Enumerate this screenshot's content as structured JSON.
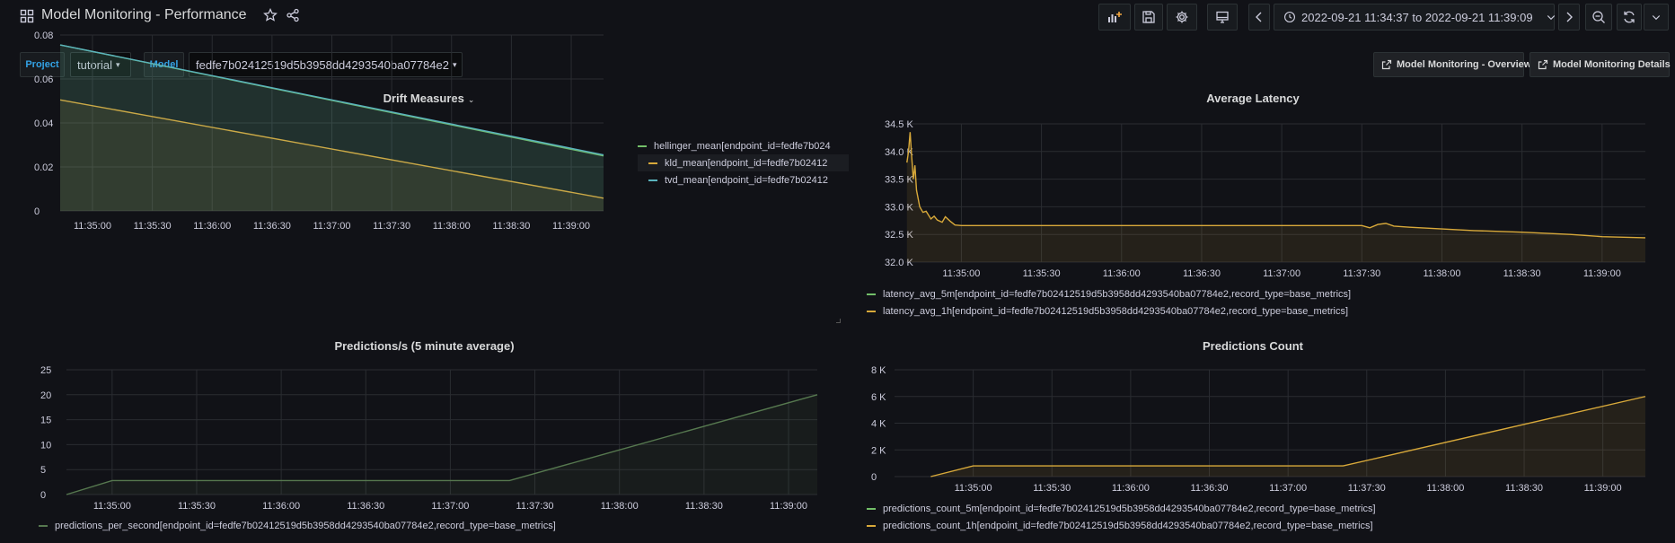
{
  "topbar": {
    "title": "Model Monitoring - Performance",
    "time_range": "2022-09-21 11:34:37 to 2022-09-21 11:39:09",
    "icons": [
      "apps-icon",
      "star-icon",
      "share-icon",
      "add-panel-icon",
      "save-icon",
      "gear-icon",
      "tv-icon",
      "chevron-left-icon",
      "clock-icon",
      "chevron-down-icon",
      "chevron-right-icon",
      "zoom-out-icon",
      "refresh-icon"
    ]
  },
  "variables": {
    "project_label": "Project",
    "project_value": "tutorial",
    "model_label": "Model",
    "model_value": "fedfe7b02412519d5b3958dd4293540ba07784e2"
  },
  "links": [
    {
      "label": "Model Monitoring - Overview"
    },
    {
      "label": "Model Monitoring Details"
    }
  ],
  "colors": {
    "background": "#111217",
    "green": "#73bf69",
    "green_dim": "#56784f",
    "yellow": "#d8a93a",
    "cyan": "#5ab3bd",
    "accent": "#33a2e5",
    "grid": "#2a2c31",
    "tick_text": "#ccccdc"
  },
  "panels": {
    "drift": {
      "title": "Drift Measures",
      "chart_data": {
        "type": "line",
        "x": [
          "11:35:00",
          "11:35:30",
          "11:36:00",
          "11:36:30",
          "11:37:00",
          "11:37:30",
          "11:38:00",
          "11:38:30",
          "11:39:00"
        ],
        "xlim": [
          -0.27,
          4.27
        ],
        "yticks": [
          "0",
          "0.02",
          "0.04",
          "0.06",
          "0.08"
        ],
        "ylim": [
          0,
          0.08
        ],
        "series": [
          {
            "name": "hellinger_mean[endpoint_id=fedfe7b024",
            "color": "#73bf69",
            "points": [
              [
                -0.27,
                0.0755
              ],
              [
                4.27,
                0.025
              ]
            ]
          },
          {
            "name": "kld_mean[endpoint_id=fedfe7b02412",
            "color": "#d8a93a",
            "points": [
              [
                -0.27,
                0.0505
              ],
              [
                4.27,
                0.0058
              ]
            ]
          },
          {
            "name": "tvd_mean[endpoint_id=fedfe7b02412",
            "color": "#5ab3bd",
            "points": [
              [
                -0.27,
                0.0755
              ],
              [
                4.27,
                0.0255
              ]
            ]
          }
        ]
      }
    },
    "latency": {
      "title": "Average Latency",
      "chart_data": {
        "type": "line",
        "x": [
          "11:35:00",
          "11:35:30",
          "11:36:00",
          "11:36:30",
          "11:37:00",
          "11:37:30",
          "11:38:00",
          "11:38:30",
          "11:39:00"
        ],
        "xlim": [
          -0.35,
          4.27
        ],
        "yticks": [
          "32.0 K",
          "32.5 K",
          "33.0 K",
          "33.5 K",
          "34.0 K",
          "34.5 K"
        ],
        "ylim": [
          32000,
          34500
        ],
        "series": [
          {
            "name": "latency_avg_5m[endpoint_id=fedfe7b02412519d5b3958dd4293540ba07784e2,record_type=base_metrics]",
            "color": "#73bf69",
            "points": []
          },
          {
            "name": "latency_avg_1h[endpoint_id=fedfe7b02412519d5b3958dd4293540ba07784e2,record_type=base_metrics]",
            "color": "#d8a93a",
            "points": [
              [
                -0.34,
                33800
              ],
              [
                -0.33,
                34000
              ],
              [
                -0.32,
                34350
              ],
              [
                -0.31,
                33900
              ],
              [
                -0.3,
                33500
              ],
              [
                -0.29,
                33750
              ],
              [
                -0.28,
                33300
              ],
              [
                -0.26,
                33000
              ],
              [
                -0.24,
                32900
              ],
              [
                -0.22,
                32920
              ],
              [
                -0.19,
                32780
              ],
              [
                -0.17,
                32830
              ],
              [
                -0.15,
                32760
              ],
              [
                -0.12,
                32720
              ],
              [
                -0.1,
                32820
              ],
              [
                -0.07,
                32740
              ],
              [
                -0.04,
                32670
              ],
              [
                0.0,
                32660
              ],
              [
                1.5,
                32660
              ],
              [
                2.2,
                32660
              ],
              [
                2.5,
                32660
              ],
              [
                2.55,
                32620
              ],
              [
                2.6,
                32680
              ],
              [
                2.65,
                32700
              ],
              [
                2.7,
                32650
              ],
              [
                2.8,
                32630
              ],
              [
                3.0,
                32600
              ],
              [
                3.2,
                32570
              ],
              [
                3.5,
                32540
              ],
              [
                3.8,
                32500
              ],
              [
                4.0,
                32460
              ],
              [
                4.27,
                32440
              ]
            ]
          }
        ]
      }
    },
    "predictions_rate": {
      "title": "Predictions/s (5 minute average)",
      "chart_data": {
        "type": "line",
        "x": [
          "11:35:00",
          "11:35:30",
          "11:36:00",
          "11:36:30",
          "11:37:00",
          "11:37:30",
          "11:38:00",
          "11:38:30",
          "11:39:00"
        ],
        "xlim": [
          -0.27,
          4.17
        ],
        "yticks": [
          "0",
          "5",
          "10",
          "15",
          "20",
          "25"
        ],
        "ylim": [
          0,
          25
        ],
        "series": [
          {
            "name": "predictions_per_second[endpoint_id=fedfe7b02412519d5b3958dd4293540ba07784e2,record_type=base_metrics]",
            "color": "#56784f",
            "points": [
              [
                -0.27,
                0
              ],
              [
                0.0,
                2.8
              ],
              [
                2.35,
                2.8
              ],
              [
                4.17,
                20
              ]
            ]
          }
        ]
      }
    },
    "predictions_count": {
      "title": "Predictions Count",
      "chart_data": {
        "type": "line",
        "x": [
          "11:35:00",
          "11:35:30",
          "11:36:00",
          "11:36:30",
          "11:37:00",
          "11:37:30",
          "11:38:00",
          "11:38:30",
          "11:39:00"
        ],
        "xlim": [
          -0.5,
          4.27
        ],
        "yticks": [
          "0",
          "2 K",
          "4 K",
          "6 K",
          "8 K"
        ],
        "ylim": [
          0,
          8000
        ],
        "series": [
          {
            "name": "predictions_count_5m[endpoint_id=fedfe7b02412519d5b3958dd4293540ba07784e2,record_type=base_metrics]",
            "color": "#73bf69",
            "points": []
          },
          {
            "name": "predictions_count_1h[endpoint_id=fedfe7b02412519d5b3958dd4293540ba07784e2,record_type=base_metrics]",
            "color": "#d8a93a",
            "points": [
              [
                -0.27,
                0
              ],
              [
                0.0,
                800
              ],
              [
                2.35,
                800
              ],
              [
                4.27,
                6000
              ]
            ]
          }
        ]
      }
    }
  }
}
